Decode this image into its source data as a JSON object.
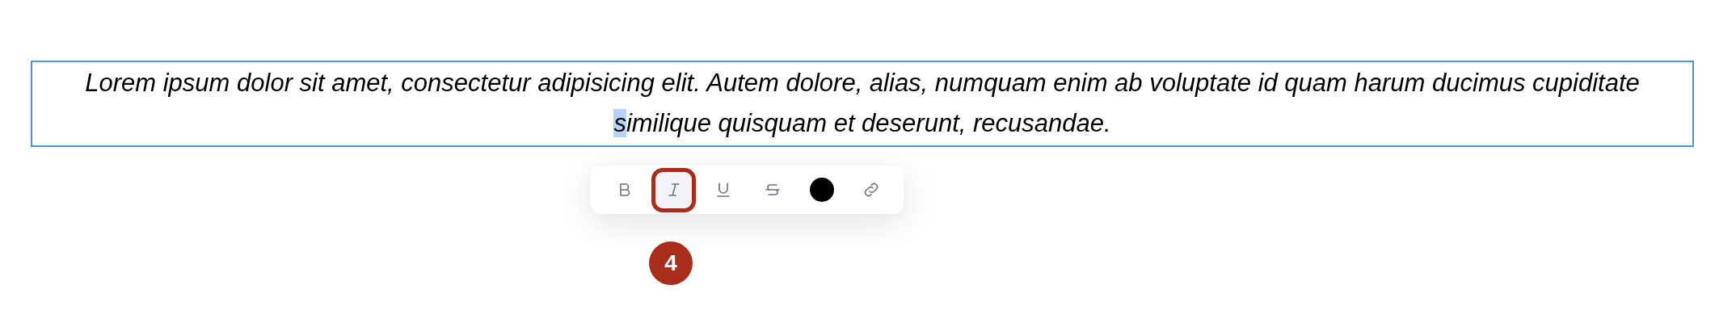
{
  "paragraph": {
    "before": "Lorem ipsum dolor sit amet, consectetur adipisicing elit. Autem dolore, alias, numquam enim ab voluptate id quam harum ducimus cupiditate ",
    "selected": "s",
    "after": "imilique quisquam et deserunt, recusandae."
  },
  "toolbar": [
    {
      "kind": "bold",
      "selected": false
    },
    {
      "kind": "italic",
      "selected": true
    },
    {
      "kind": "underline",
      "selected": false
    },
    {
      "kind": "strikethrough",
      "selected": false
    },
    {
      "kind": "color",
      "selected": false,
      "color": "#000000"
    },
    {
      "kind": "link",
      "selected": false
    }
  ],
  "step_badge": "4"
}
